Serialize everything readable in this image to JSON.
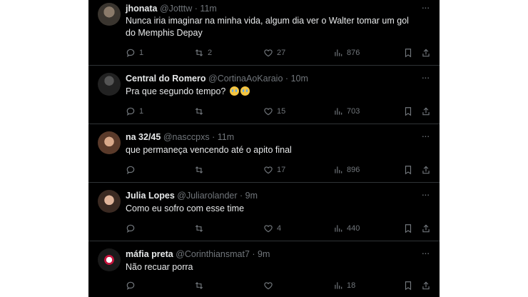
{
  "colors": {
    "background": "#000000",
    "text_primary": "#e7e9ea",
    "text_secondary": "#71767b",
    "divider": "#2f3336"
  },
  "icons": {
    "reply": "reply-icon",
    "retweet": "retweet-icon",
    "like": "heart-icon",
    "views": "views-icon",
    "bookmark": "bookmark-icon",
    "share": "share-icon",
    "more": "more-icon"
  },
  "tweets": [
    {
      "name": "jhonata",
      "handle": "@Jotttw",
      "separator": "·",
      "time": "11m",
      "text": "Nunca iria imaginar na minha vida, algum dia ver o Walter tomar um gol do Memphis Depay",
      "replies": "1",
      "retweets": "2",
      "likes": "27",
      "views": "876"
    },
    {
      "name": "Central do Romero",
      "handle": "@CortinaAoKaraio",
      "separator": "·",
      "time": "10m",
      "text": "Pra que segundo tempo?",
      "replies": "1",
      "retweets": "",
      "likes": "15",
      "views": "703"
    },
    {
      "name": "na 32/45",
      "handle": "@nasccpxs",
      "separator": "·",
      "time": "11m",
      "text": "que permaneça vencendo até o apito final",
      "replies": "",
      "retweets": "",
      "likes": "17",
      "views": "896"
    },
    {
      "name": "Julia Lopes",
      "handle": "@Juliarolander",
      "separator": "·",
      "time": "9m",
      "text": "Como eu sofro com esse time",
      "replies": "",
      "retweets": "",
      "likes": "4",
      "views": "440"
    },
    {
      "name": "máfia preta",
      "handle": "@Corinthiansmat7",
      "separator": "·",
      "time": "9m",
      "text": "Não recuar porra",
      "replies": "",
      "retweets": "",
      "likes": "",
      "views": "18"
    }
  ]
}
